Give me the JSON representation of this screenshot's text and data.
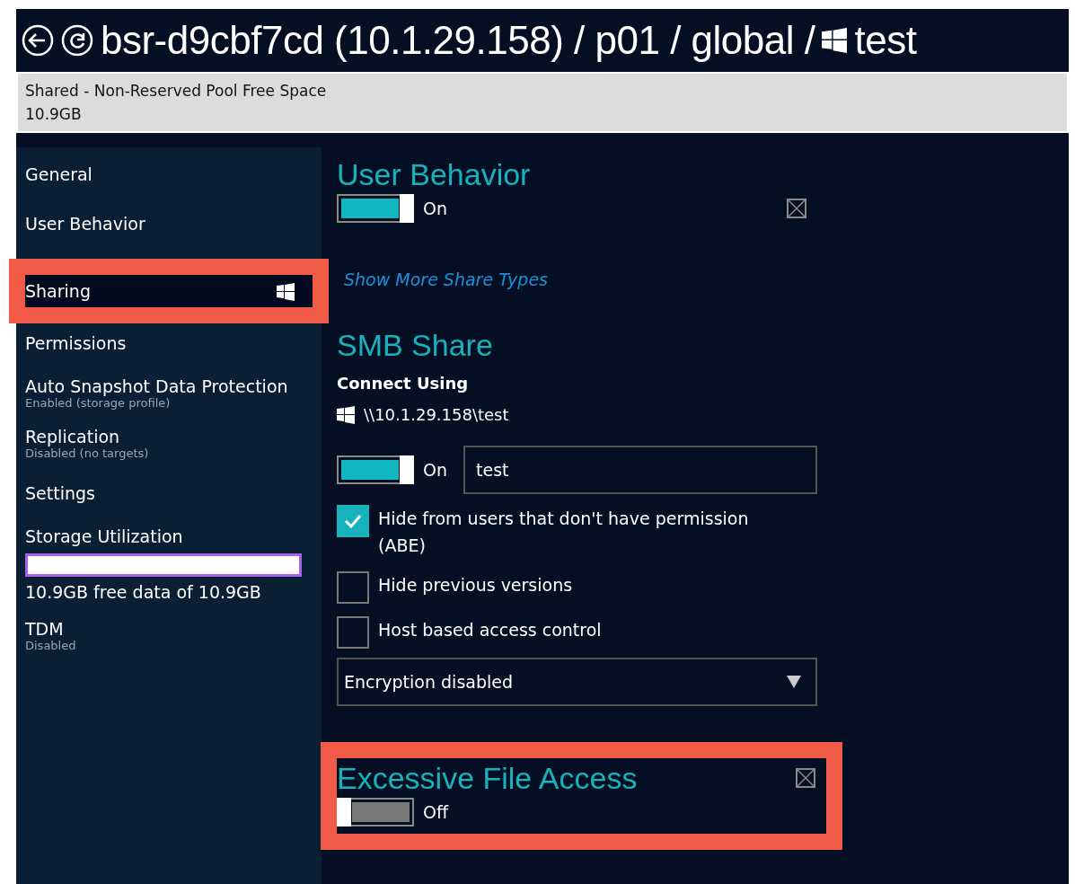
{
  "header": {
    "path": "bsr-d9cbf7cd (10.1.29.158) / p01 / global /",
    "name": "test"
  },
  "pool_bar": {
    "label": "Shared - Non-Reserved Pool Free Space",
    "value": "10.9GB"
  },
  "sidebar": {
    "items": [
      {
        "label": "General",
        "selected": false,
        "highlighted": false
      },
      {
        "label": "User Behavior",
        "selected": false,
        "highlighted": false
      },
      {
        "label": "Sharing",
        "selected": true,
        "highlighted": true,
        "windows_icon": true
      },
      {
        "label": "Permissions",
        "selected": false,
        "highlighted": false
      },
      {
        "label": "Auto Snapshot Data Protection",
        "sub": "Enabled (storage profile)",
        "selected": false,
        "highlighted": false
      },
      {
        "label": "Replication",
        "sub": "Disabled (no targets)",
        "selected": false,
        "highlighted": false
      },
      {
        "label": "Settings",
        "selected": false,
        "highlighted": false
      },
      {
        "label": "Storage Utilization",
        "selected": false,
        "highlighted": false,
        "meter": {
          "level": 1,
          "caption": "10.9GB free data of 10.9GB"
        }
      },
      {
        "label": "TDM",
        "sub": "Disabled",
        "selected": false,
        "highlighted": false
      }
    ]
  },
  "user_behavior": {
    "title": "User Behavior",
    "toggle": {
      "on": true,
      "label": "On"
    },
    "link": "Show More Share Types"
  },
  "smb_share": {
    "title": "SMB Share",
    "connect_label": "Connect Using",
    "path": "\\\\10.1.29.158\\test",
    "toggle": {
      "on": true,
      "label": "On"
    },
    "share_name": "test",
    "options": [
      {
        "label": "Hide from users that don't have permission (ABE)",
        "checked": true
      },
      {
        "label": "Hide previous versions",
        "checked": false
      },
      {
        "label": "Host based access control",
        "checked": false
      }
    ],
    "encryption": "Encryption disabled"
  },
  "excessive_file_access": {
    "title": "Excessive File Access",
    "highlighted": true,
    "toggle": {
      "on": false,
      "label": "Off"
    }
  }
}
